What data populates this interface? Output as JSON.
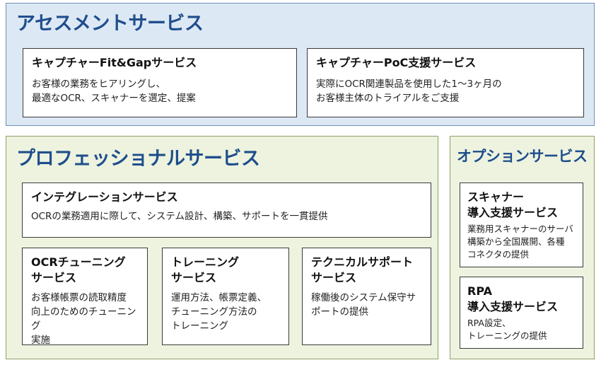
{
  "assessment": {
    "title": "アセスメントサービス",
    "cards": [
      {
        "title": "キャプチャーFit&Gapサービス",
        "body": "お客様の業務をヒアリングし、\n最適なOCR、スキャナーを選定、提案"
      },
      {
        "title": "キャプチャーPoC支援サービス",
        "body": "実際にOCR関連製品を使用した1～3ヶ月の\nお客様主体のトライアルをご支援"
      }
    ]
  },
  "professional": {
    "title": "プロフェッショナルサービス",
    "integration": {
      "title": "インテグレーションサービス",
      "body": "OCRの業務適用に際して、システム設計、構築、サポートを一貫提供"
    },
    "cards": [
      {
        "title": "OCRチューニング\nサービス",
        "body": "お客様帳票の読取精度\n向上のためのチューニング\n実施"
      },
      {
        "title": "トレーニング\nサービス",
        "body": "運用方法、帳票定義、\nチューニング方法の\nトレーニング"
      },
      {
        "title": "テクニカルサポート\nサービス",
        "body": "稼働後のシステム保守サ\nポートの提供"
      }
    ]
  },
  "option": {
    "title": "オプションサービス",
    "cards": [
      {
        "title": "スキャナー\n導入支援サービス",
        "body": "業務用スキャナーのサーバ\n構築から全国展開、各種\nコネクタの提供"
      },
      {
        "title": "RPA\n導入支援サービス",
        "body": "RPA設定、\nトレーニングの提供"
      }
    ]
  }
}
